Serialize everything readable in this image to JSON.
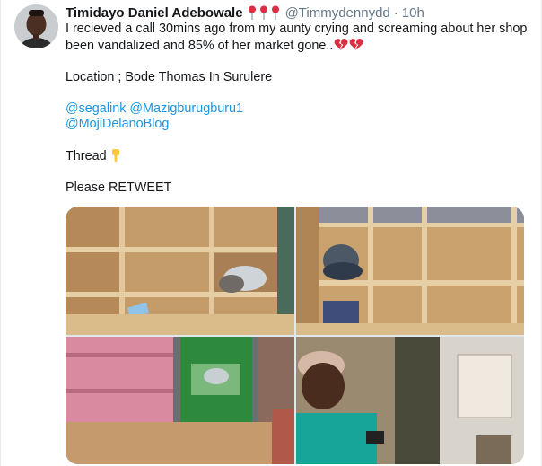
{
  "tweet": {
    "display_name": "Timidayo Daniel Adebowale",
    "handle": "@Timmydennydd",
    "separator": "·",
    "time": "10h",
    "name_emojis": [
      "round-pushpin",
      "round-pushpin",
      "round-pushpin"
    ],
    "text": {
      "line1": "I recieved a call 30mins ago from my aunty crying and screaming about her shop",
      "line2": "been vandalized and 85% of her market gone..",
      "line2_emojis": [
        "broken-heart",
        "broken-heart"
      ],
      "location": "Location ; Bode Thomas In Surulere",
      "mention1": "@segalink",
      "mention2": "@Mazigburugburu1",
      "mention3": "@MojiDelanoBlog",
      "thread": "Thread",
      "thread_emoji": "backhand-index-pointing-down",
      "retweet": "Please RETWEET"
    },
    "colors": {
      "link": "#1b95e0",
      "muted": "#657786",
      "text": "#14171a"
    },
    "media": [
      {
        "description_icon": "empty-shop-shelves-photo"
      },
      {
        "description_icon": "shelves-with-bags-photo"
      },
      {
        "description_icon": "broken-pink-shelf-photo"
      },
      {
        "description_icon": "woman-in-shop-photo"
      }
    ]
  }
}
